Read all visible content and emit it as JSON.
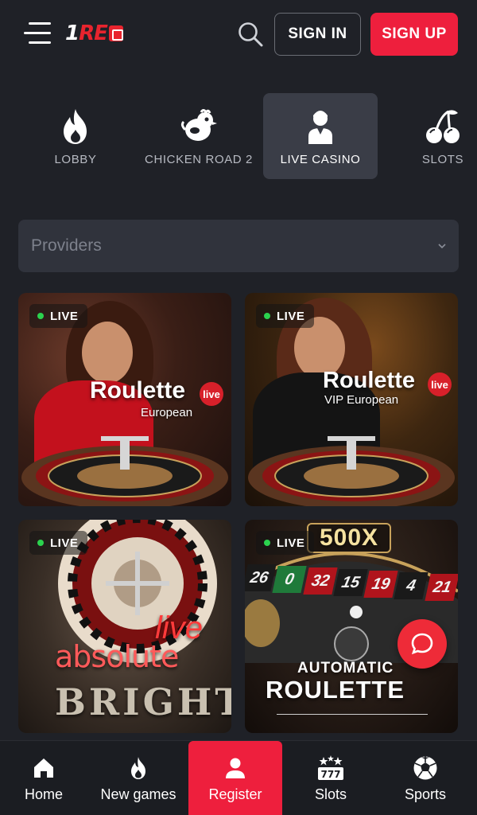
{
  "header": {
    "logo": {
      "part1": "1",
      "part2": "RE"
    },
    "signin_label": "SIGN IN",
    "signup_label": "SIGN UP"
  },
  "categories": [
    {
      "label": "LOBBY",
      "icon": "flame-icon",
      "active": false
    },
    {
      "label": "CHICKEN ROAD 2",
      "icon": "chicken-icon",
      "active": false
    },
    {
      "label": "LIVE CASINO",
      "icon": "dealer-icon",
      "active": true
    },
    {
      "label": "SLOTS",
      "icon": "cherries-icon",
      "active": false
    }
  ],
  "providers": {
    "placeholder": "Providers"
  },
  "games": [
    {
      "badge": "LIVE",
      "title": "Roulette",
      "subtitle": "European",
      "live_tag": "live"
    },
    {
      "badge": "LIVE",
      "title": "Roulette",
      "subtitle": "VIP European",
      "live_tag": "live"
    },
    {
      "badge": "LIVE",
      "title_line1": "live",
      "title_line2": "absolute",
      "title_line3": "BRIGHT"
    },
    {
      "badge": "LIVE",
      "multiplier": "500X",
      "title_line1": "AUTOMATIC",
      "title_line2": "ROULETTE",
      "wheel_numbers": [
        "26",
        "0",
        "32",
        "15",
        "19",
        "4",
        "21"
      ]
    }
  ],
  "bottom_nav": [
    {
      "label": "Home",
      "icon": "home-icon",
      "active": false
    },
    {
      "label": "New games",
      "icon": "flame-icon",
      "active": false
    },
    {
      "label": "Register",
      "icon": "user-icon",
      "active": true
    },
    {
      "label": "Slots",
      "icon": "slot-777-icon",
      "active": false
    },
    {
      "label": "Sports",
      "icon": "soccer-ball-icon",
      "active": false
    }
  ],
  "colors": {
    "background": "#1f2127",
    "accent": "#ee1f3d",
    "active_tab": "#3a3d47",
    "live_dot": "#2bd24e"
  }
}
